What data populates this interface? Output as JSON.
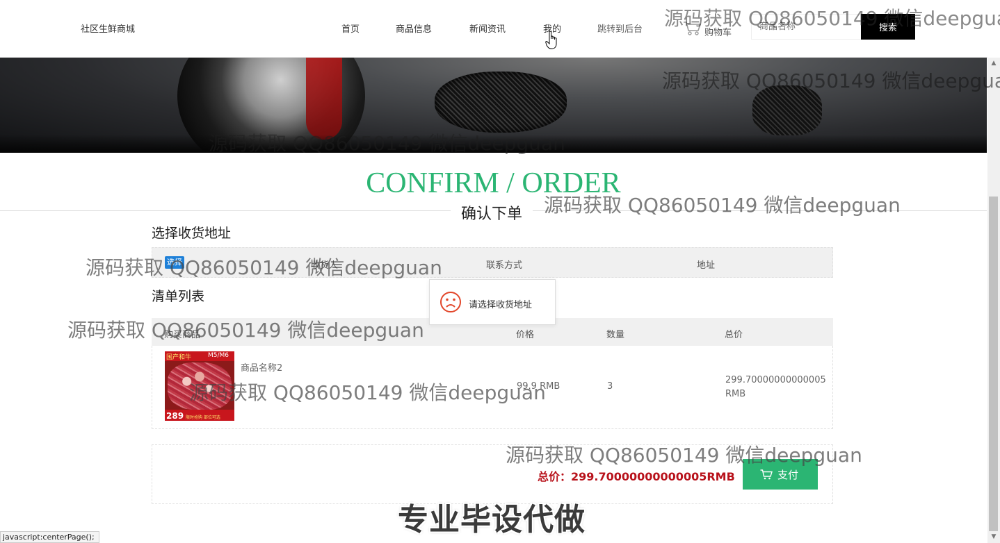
{
  "header": {
    "brand": "社区生鲜商城",
    "nav": [
      {
        "label": "首页"
      },
      {
        "label": "商品信息"
      },
      {
        "label": "新闻资讯"
      },
      {
        "label": "我的"
      },
      {
        "label": "跳转到后台"
      }
    ],
    "cart_label": "购物车",
    "search_placeholder": "商品名称",
    "search_button": "搜索"
  },
  "page": {
    "title_en": "CONFIRM / ORDER",
    "title_cn": "确认下单"
  },
  "address": {
    "section_title": "选择收货地址",
    "select_button": "选择",
    "columns": [
      "收货人",
      "联系方式",
      "地址"
    ]
  },
  "toast": {
    "icon": "sad-face-icon",
    "message": "请选择收货地址"
  },
  "order_list": {
    "section_title": "清单列表",
    "columns": [
      "购买商品",
      "价格",
      "数量",
      "总价"
    ],
    "items": [
      {
        "image_labels": {
          "badge": "国产和牛",
          "grade": "M5/M6",
          "price": "289",
          "note": "限时抢购 部位可选"
        },
        "name": "商品名称2",
        "price": "99.9 RMB",
        "quantity": "3",
        "total": "299.70000000000005 RMB"
      }
    ]
  },
  "summary": {
    "total_label": "总价：299.70000000000005RMB",
    "pay_button": "支付"
  },
  "status_bar": "javascript:centerPage();",
  "watermarks": {
    "header": "源码获取 QQ86050149 微信deepguan",
    "banner_right": "源码获取 QQ86050149 微信deepguan",
    "banner_center": "源码获取 QQ86050149 微信deepguan",
    "title_right": "源码获取 QQ86050149 微信deepguan",
    "address_row": "源码获取 QQ86050149 微信deepguan",
    "list_header": "源码获取 QQ86050149 微信deepguan",
    "list_row": "源码获取 QQ86050149 微信deepguan",
    "summary": "源码获取 QQ86050149 微信deepguan",
    "promo": "专业毕设代做"
  },
  "colors": {
    "accent_green": "#2bb573",
    "price_red": "#b8121b",
    "select_blue": "#1e80d8",
    "search_black": "#000000"
  }
}
